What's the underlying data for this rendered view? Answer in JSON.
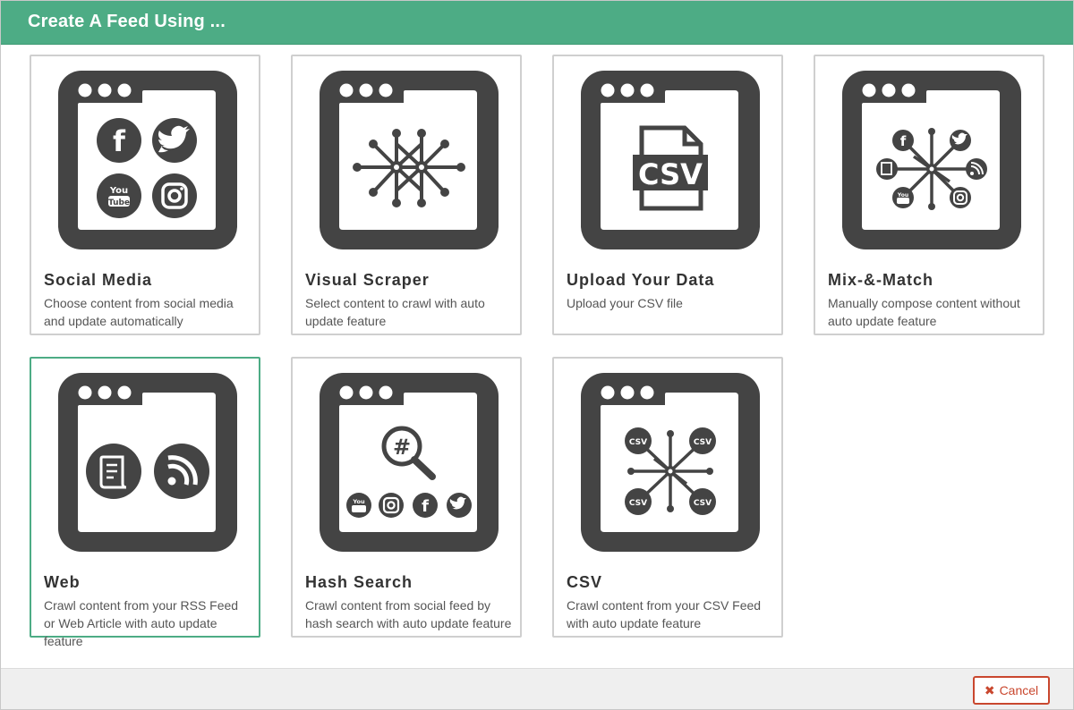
{
  "header": {
    "title": "Create A Feed Using ..."
  },
  "cards": [
    {
      "title": "Social Media",
      "description": "Choose content from social media and update automatically",
      "icon": "social-media-icon"
    },
    {
      "title": "Visual Scraper",
      "description": "Select content to crawl with auto update feature",
      "icon": "visual-scraper-icon"
    },
    {
      "title": "Upload Your Data",
      "description": "Upload your CSV file",
      "icon": "upload-csv-icon",
      "icon_text": "CSV"
    },
    {
      "title": "Mix-&-Match",
      "description": "Manually compose content without auto update feature",
      "icon": "mix-match-icon"
    },
    {
      "title": "Web",
      "description": "Crawl content from your RSS Feed or Web Article with auto update feature",
      "icon": "web-rss-icon",
      "selected": true
    },
    {
      "title": "Hash Search",
      "description": "Crawl content from social feed by hash search with auto update feature",
      "icon": "hash-search-icon",
      "icon_text": "#"
    },
    {
      "title": "CSV",
      "description": "Crawl content from your CSV Feed with auto update feature",
      "icon": "csv-feed-icon",
      "icon_text": "CSV"
    }
  ],
  "footer": {
    "cancel_label": "Cancel"
  },
  "colors": {
    "header": "#4dac85",
    "icon_dark": "#444444",
    "cancel": "#c9472e",
    "selected_border": "#4dac85"
  }
}
